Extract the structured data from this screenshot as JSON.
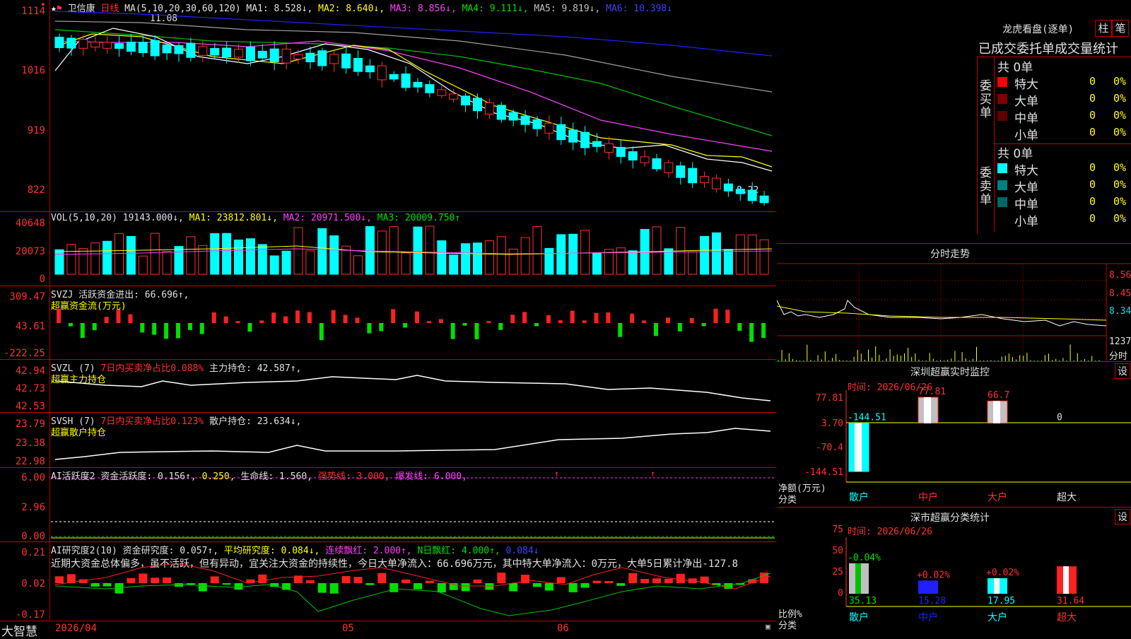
{
  "stock": {
    "name": "卫信康",
    "period": "日线",
    "ma_header": "MA(5,10,20,30,60,120)",
    "ma1": "MA1: 8.528↓,",
    "ma2": "MA2: 8.640↓,",
    "ma3": "MA3: 8.856↓,",
    "ma4": "MA4: 9.111↓,",
    "ma5": "MA5: 9.819↓,",
    "ma6": "MA6: 10.398↓",
    "high_label": "11.08",
    "low_label": "8.22",
    "y_labels": [
      "1114",
      "1016",
      "919",
      "822"
    ],
    "corner_icons": [
      "star-icon",
      "flag-icon"
    ]
  },
  "volume": {
    "header": "VOL(5,10,20)",
    "value": "19143.000↓,",
    "ma1": "MA1: 23812.801↓,",
    "ma2": "MA2: 20971.500↓,",
    "ma3": "MA3: 20009.750↑",
    "y_labels": [
      "40648",
      "20073",
      "0"
    ]
  },
  "svzj": {
    "header": "SVZJ",
    "text": "活跃资金进出: 66.696↑,",
    "sub": "超赢资金流(万元)",
    "y_labels": [
      "309.47",
      "43.61",
      "-222.25"
    ]
  },
  "svzl": {
    "header": "SVZL (7)",
    "ratio": "7日内买卖净占比0.088%",
    "hold": "主力持仓: 42.587↑,",
    "sub": "超赢主力持仓",
    "y_labels": [
      "42.94",
      "42.73",
      "42.53"
    ]
  },
  "svsh": {
    "header": "SVSH (7)",
    "ratio": "7日内买卖净占比0.123%",
    "hold": "散户持仓: 23.634↓,",
    "sub": "超赢散户持仓",
    "y_labels": [
      "23.79",
      "23.38",
      "22.98"
    ]
  },
  "ai1": {
    "header": "AI活跃度2",
    "v1": "资金活跃度: 0.156↑,",
    "v2": "0.250,",
    "v3": "生命线: 1.560,",
    "v4": "强势线: 3.000,",
    "v5": "爆发线: 6.000,",
    "y_labels": [
      "6.00",
      "2.96",
      "0.00"
    ]
  },
  "ai2": {
    "header": "AI研究度2(10)",
    "v1": "资金研究度: 0.057↑,",
    "v2": "平均研究度: 0.084↓,",
    "v3": "连续飘红: 2.000↑,",
    "v4": "N日飘红: 4.000↑,",
    "v5": "0.084↓",
    "comment": "近期大资金总体偏多，虽不活跃，但有异动，宜关注大资金的持续性，今日大单净流入：66.696万元，其中特大单净流入：0万元，大单5日累计净出-127.8",
    "y_labels": [
      "0.21",
      "0.02",
      "-0.17"
    ]
  },
  "footer": {
    "brand": "大智慧",
    "dates": [
      "2026/04",
      "05",
      "06"
    ]
  },
  "dragon": {
    "title": "龙虎看盘(逐单)",
    "btn1": "柱",
    "btn2": "笔",
    "table_title": "已成交委托单成交量统计",
    "buy_label": "委买单",
    "sell_label": "委卖单",
    "buy_total": "共 0单",
    "sell_total": "共 0单",
    "buy_rows": [
      {
        "name": "特大",
        "count": "0",
        "pct": "0%",
        "color": "#ff0000"
      },
      {
        "name": "大单",
        "count": "0",
        "pct": "0%",
        "color": "#800000"
      },
      {
        "name": "中单",
        "count": "0",
        "pct": "0%",
        "color": "#600000"
      },
      {
        "name": "小单",
        "count": "0",
        "pct": "0%",
        "color": ""
      }
    ],
    "sell_rows": [
      {
        "name": "特大",
        "count": "0",
        "pct": "0%",
        "color": "#00ffff"
      },
      {
        "name": "大单",
        "count": "0",
        "pct": "0%",
        "color": "#008080"
      },
      {
        "name": "中单",
        "count": "0",
        "pct": "0%",
        "color": "#006666"
      },
      {
        "name": "小单",
        "count": "0",
        "pct": "0%",
        "color": ""
      }
    ]
  },
  "minute": {
    "title": "分时走势",
    "y_labels": [
      "8.56",
      "8.45",
      "8.34"
    ],
    "vol_label": "1237",
    "vol_unit": "分时"
  },
  "monitor": {
    "title": "深圳超赢实时监控",
    "btn": "设",
    "time": "时间: 2026/06/26",
    "y_labels": [
      "77.81",
      "3.70",
      "-70.4",
      "-144.51"
    ],
    "unit1": "净额(万元)",
    "unit2": "分类",
    "bars": [
      {
        "cat": "散户",
        "value": -144.51,
        "label": "-144.51"
      },
      {
        "cat": "中户",
        "value": 77.81,
        "label": "77.81"
      },
      {
        "cat": "大户",
        "value": 66.7,
        "label": "66.7"
      },
      {
        "cat": "超大",
        "value": 0,
        "label": "0"
      }
    ]
  },
  "classify": {
    "title": "深市超赢分类统计",
    "btn": "设",
    "time": "时间: 2026/06/26",
    "y_labels": [
      "75",
      "50",
      "25",
      "0"
    ],
    "unit1": "比例%",
    "unit2": "分类",
    "bars": [
      {
        "cat": "散户",
        "value": 35.13,
        "label": "35.13",
        "change": "-0.04%"
      },
      {
        "cat": "中户",
        "value": 15.28,
        "label": "15.28",
        "change": "+0.02%"
      },
      {
        "cat": "大户",
        "value": 17.95,
        "label": "17.95",
        "change": "+0.02%"
      },
      {
        "cat": "超大",
        "value": 31.64,
        "label": "31.64",
        "change": ""
      }
    ]
  },
  "chart_data": {
    "type": "bar",
    "title": "深圳超赢实时监控",
    "categories": [
      "散户",
      "中户",
      "大户",
      "超大"
    ],
    "values": [
      -144.51,
      77.81,
      66.7,
      0
    ],
    "ylabel": "净额(万元)",
    "ylim": [
      -144.51,
      77.81
    ]
  }
}
